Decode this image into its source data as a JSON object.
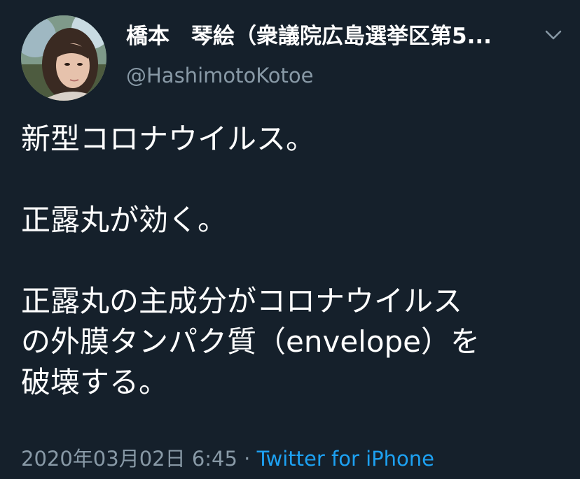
{
  "user": {
    "display_name": "橋本　琴絵（衆議院広島選挙区第5...",
    "handle": "@HashimotoKotoe"
  },
  "menu": {
    "icon": "chevron-down-icon"
  },
  "tweet": {
    "lines": [
      "新型コロナウイルス。",
      "正露丸が効く。",
      "正露丸の主成分がコロナウイルス",
      "の外膜タンパク質（envelope）を",
      "破壊する。"
    ]
  },
  "meta": {
    "timestamp": "2020年03月02日 6:45",
    "separator": "·",
    "source": "Twitter for iPhone"
  },
  "colors": {
    "background": "#15202b",
    "text": "#ffffff",
    "secondary_text": "#8899a6",
    "link": "#1da1f2"
  }
}
